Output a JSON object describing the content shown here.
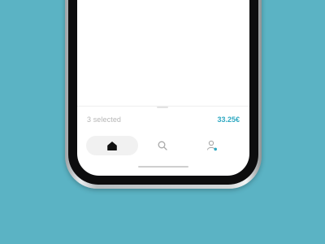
{
  "colors": {
    "background": "#5bb3c4",
    "accent": "#2fa9c2",
    "muted_text": "#b6b6b6",
    "active_tab_bg": "#f1f1f1"
  },
  "summary": {
    "selected_label": "3 selected",
    "total_price": "33.25€"
  },
  "tabs": [
    {
      "icon": "home-icon",
      "active": true
    },
    {
      "icon": "search-icon",
      "active": false
    },
    {
      "icon": "profile-icon",
      "active": false,
      "notification_dot": true
    }
  ]
}
